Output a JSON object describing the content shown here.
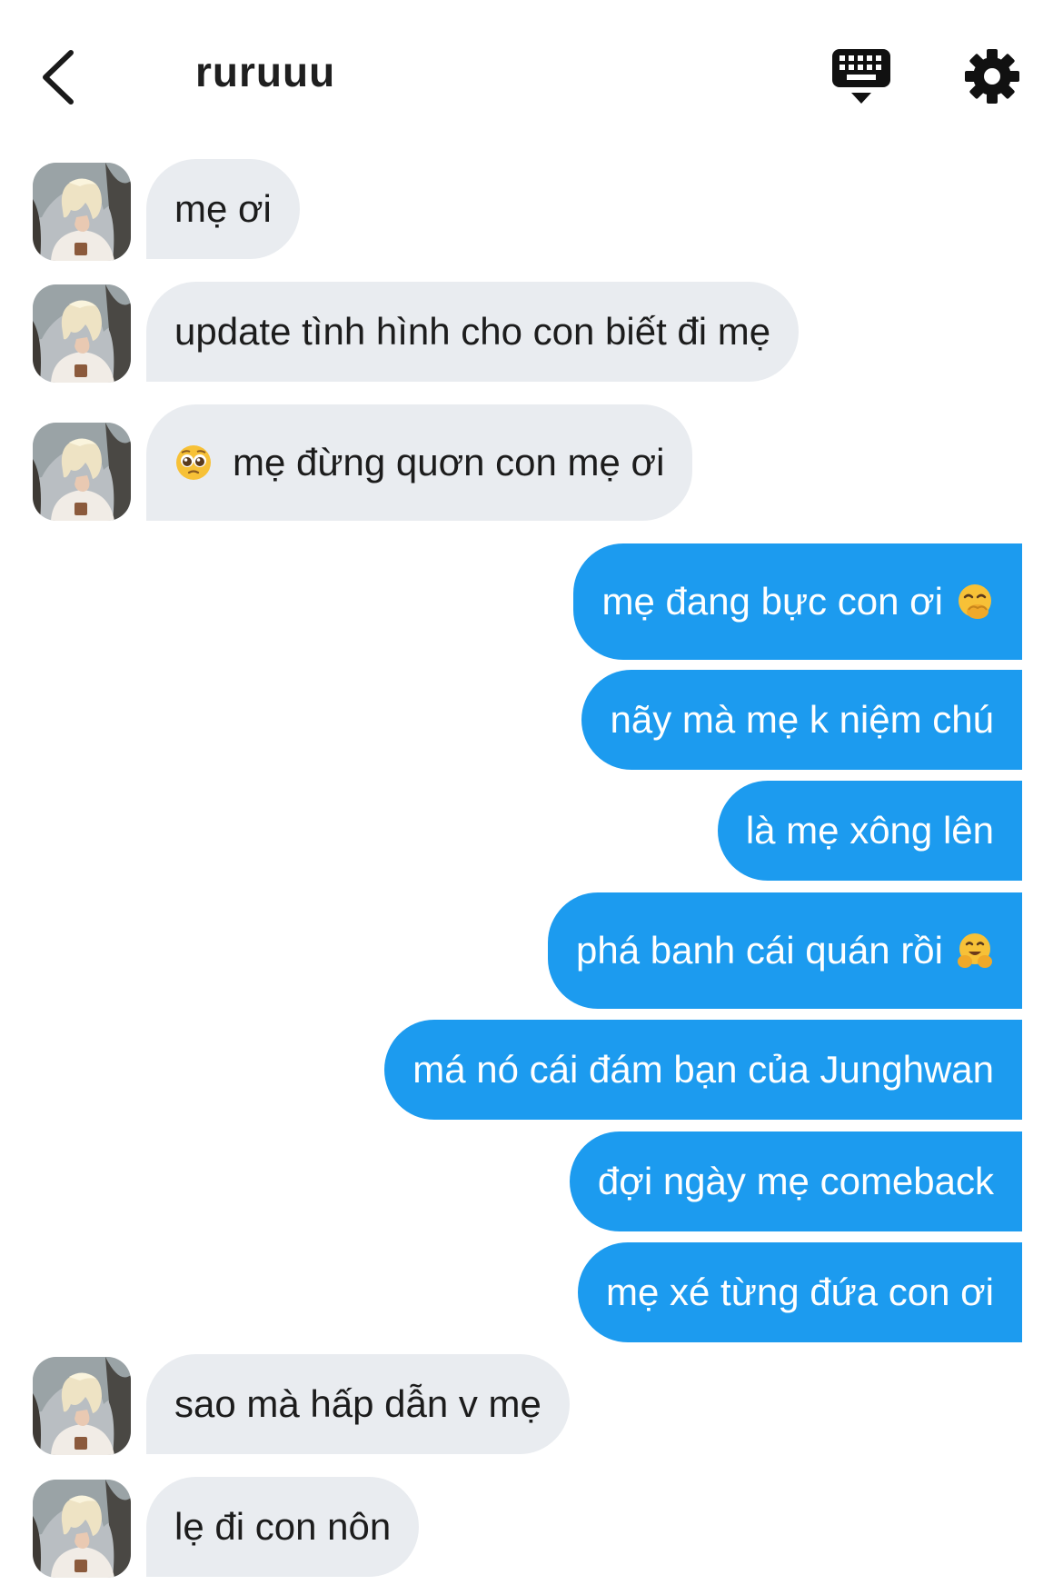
{
  "header": {
    "contact_name": "ruruuu"
  },
  "messages": [
    {
      "direction": "incoming",
      "text": "mẹ ơi"
    },
    {
      "direction": "incoming",
      "text": "update tình hình cho con biết đi mẹ"
    },
    {
      "direction": "incoming",
      "text": "mẹ đừng quơn con mẹ ơi",
      "leading_emoji": "pleading-face"
    },
    {
      "direction": "outgoing",
      "text": "mẹ đang bực con ơi",
      "trailing_emoji": "face-with-hand-over-mouth"
    },
    {
      "direction": "outgoing",
      "text": "nãy mà mẹ k niệm chú"
    },
    {
      "direction": "outgoing",
      "text": "là mẹ xông lên"
    },
    {
      "direction": "outgoing",
      "text": "phá banh cái quán rồi",
      "trailing_emoji": "hugging-face"
    },
    {
      "direction": "outgoing",
      "text": "má nó cái đám bạn của Junghwan"
    },
    {
      "direction": "outgoing",
      "text": "đợi ngày mẹ comeback"
    },
    {
      "direction": "outgoing",
      "text": "mẹ xé từng đứa con ơi"
    },
    {
      "direction": "incoming",
      "text": "sao mà hấp dẫn v mẹ"
    },
    {
      "direction": "incoming",
      "text": "lẹ đi con nôn"
    }
  ],
  "colors": {
    "outgoing_bubble": "#1c9bef",
    "incoming_bubble": "#e9ecf0",
    "incoming_text": "#1c1c1c",
    "outgoing_text": "#ffffff"
  }
}
